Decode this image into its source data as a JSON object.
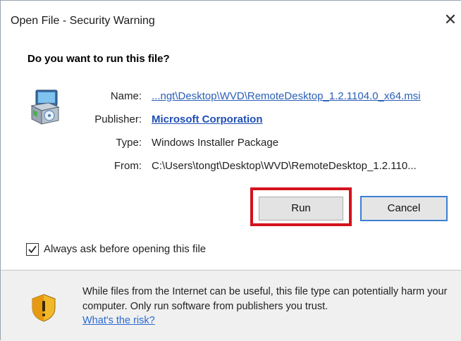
{
  "window": {
    "title": "Open File - Security Warning",
    "close_glyph": "✕"
  },
  "prompt": {
    "heading": "Do you want to run this file?"
  },
  "file_info": {
    "icon": "installer-package-icon",
    "rows": [
      {
        "label": "Name:",
        "value": "...ngt\\Desktop\\WVD\\RemoteDesktop_1.2.1104.0_x64.msi"
      },
      {
        "label": "Publisher:",
        "value": "Microsoft Corporation"
      },
      {
        "label": "Type:",
        "value": "Windows Installer Package"
      },
      {
        "label": "From:",
        "value": "C:\\Users\\tongt\\Desktop\\WVD\\RemoteDesktop_1.2.110..."
      }
    ]
  },
  "buttons": {
    "run_label": "Run",
    "cancel_label": "Cancel",
    "highlight_color": "#d4121d"
  },
  "checkbox": {
    "checked": true,
    "label": "Always ask before opening this file"
  },
  "footer": {
    "icon": "warning-shield-icon",
    "warning_text": "While files from the Internet can be useful, this file type can potentially harm your computer. Only run software from publishers you trust.",
    "risk_link": "What's the risk?"
  },
  "colors": {
    "link": "#2a5fb8",
    "footer_bg": "#f0f0f0",
    "cancel_border": "#3c7fd1"
  }
}
